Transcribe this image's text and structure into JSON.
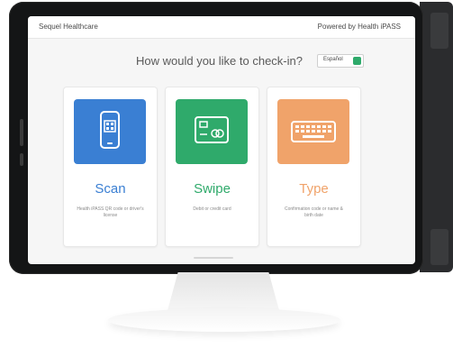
{
  "header": {
    "left_title": "Sequel Healthcare",
    "right_title": "Powered by Health iPASS"
  },
  "prompt": "How would you like to check-in?",
  "language_toggle": {
    "label": "Español"
  },
  "options": [
    {
      "title": "Scan",
      "subtitle": "Health iPASS QR code or driver's license",
      "color": "#3a7fd3",
      "icon": "phone-qr-icon"
    },
    {
      "title": "Swipe",
      "subtitle": "Debit or credit card",
      "color": "#2faa6b",
      "icon": "credit-card-icon"
    },
    {
      "title": "Type",
      "subtitle": "Confirmation code or name & birth date",
      "color": "#f0a36a",
      "icon": "keyboard-icon"
    }
  ]
}
